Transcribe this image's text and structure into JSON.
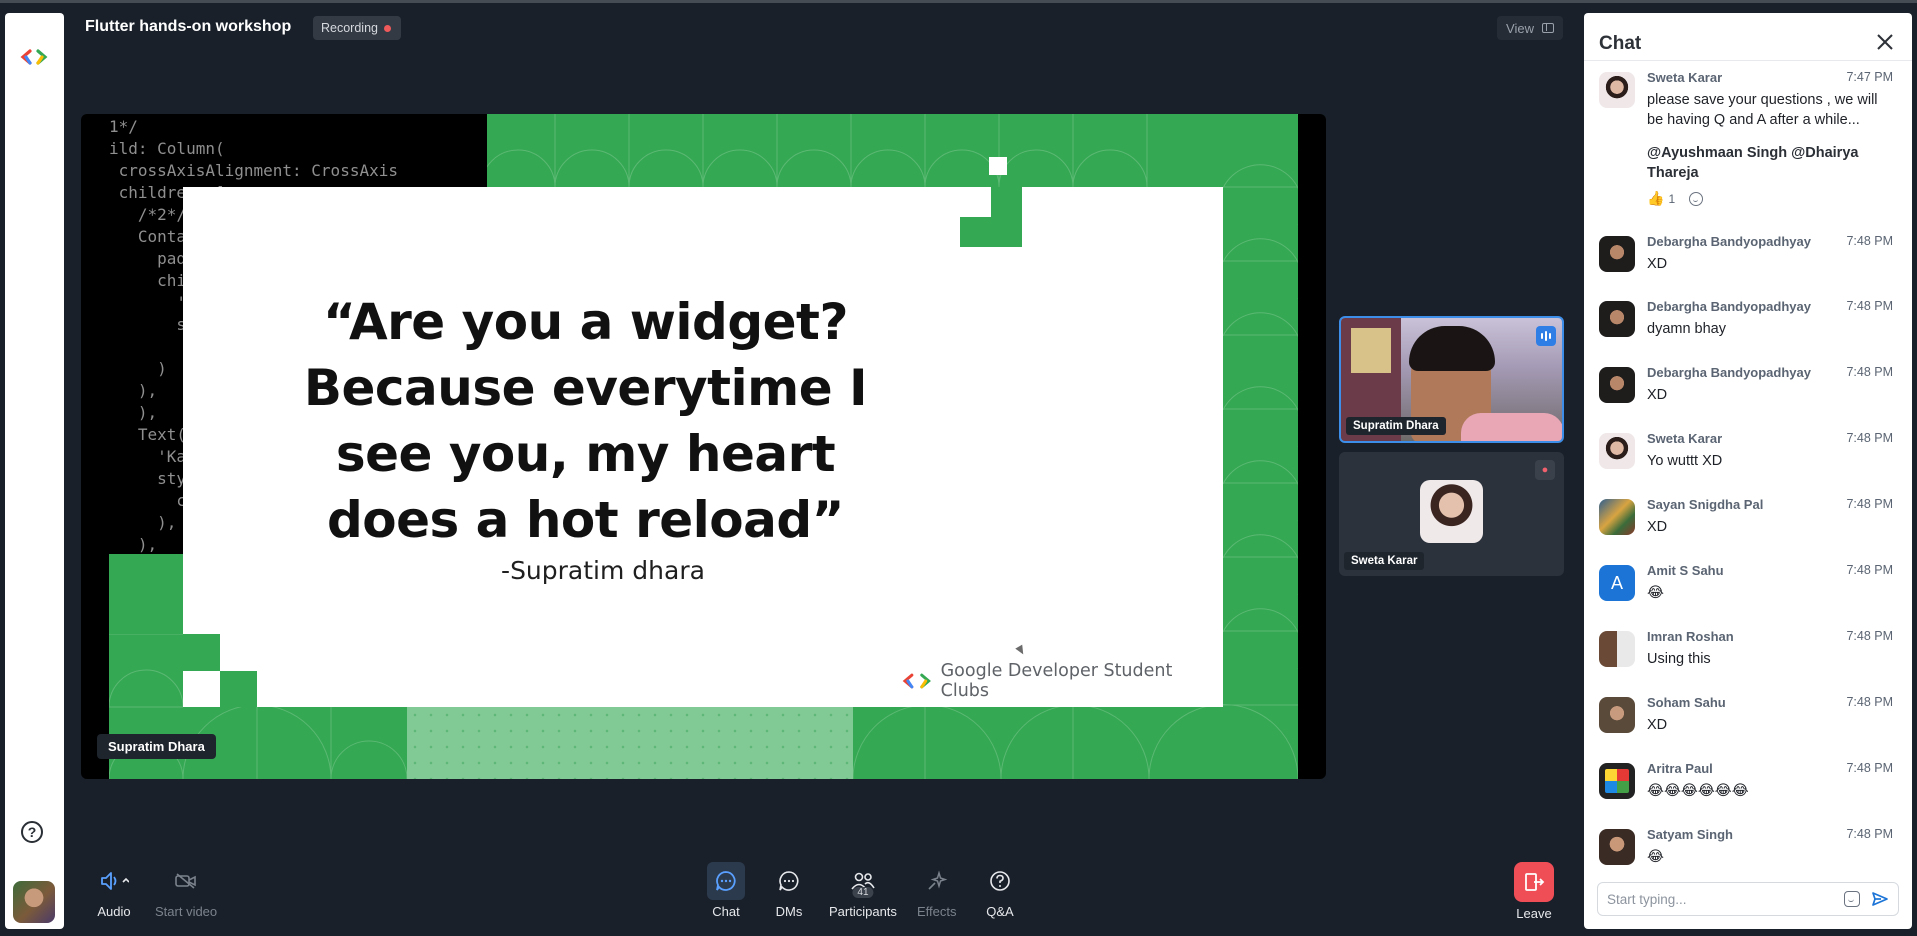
{
  "meeting": {
    "title": "Flutter hands-on workshop",
    "recording_label": "Recording",
    "view_label": "View"
  },
  "stage": {
    "speaker_label": "Supratim Dhara",
    "code_lines": [
      "1*/",
      "ild: Column(",
      " crossAxisAlignment: CrossAxis",
      " children: [",
      "   /*2*/",
      "   Conta",
      "     pad",
      "     chi",
      "       '",
      "       s",
      "       ",
      "     )",
      "   ),",
      "   ),",
      "   Text(",
      "     'Ka",
      "     sty",
      "       c",
      "     ),",
      "   ),",
      " ],"
    ],
    "slide": {
      "quote": "“Are you a widget?Because everytime I see you, my heart does a hot reload”",
      "author": "-Supratim dhara",
      "brand": "Google Developer Student Clubs"
    }
  },
  "tiles": [
    {
      "name": "Supratim Dhara",
      "speaking": true
    },
    {
      "name": "Sweta Karar",
      "muted": true
    }
  ],
  "toolbar": {
    "audio": "Audio",
    "video": "Start video",
    "chat": "Chat",
    "dms": "DMs",
    "participants": "Participants",
    "participants_count": "41",
    "effects": "Effects",
    "qa": "Q&A",
    "leave": "Leave"
  },
  "chat": {
    "title": "Chat",
    "input_placeholder": "Start typing...",
    "messages": [
      {
        "name": "Sweta Karar",
        "time": "7:47 PM",
        "text": "please save your questions , we will be having Q and A after a while...",
        "mention": "@Ayushmaan Singh @Dhairya Thareja",
        "reaction_emoji": "👍",
        "reaction_count": "1"
      },
      {
        "name": "Debargha Bandyopadhyay",
        "time": "7:48 PM",
        "text": "XD"
      },
      {
        "name": "Debargha Bandyopadhyay",
        "time": "7:48 PM",
        "text": "dyamn bhay"
      },
      {
        "name": "Debargha Bandyopadhyay",
        "time": "7:48 PM",
        "text": "XD"
      },
      {
        "name": "Sweta Karar",
        "time": "7:48 PM",
        "text": "Yo wuttt XD"
      },
      {
        "name": "Sayan Snigdha Pal",
        "time": "7:48 PM",
        "text": "XD"
      },
      {
        "name": "Amit S Sahu",
        "time": "7:48 PM",
        "text": "😂",
        "avatar_letter": "A"
      },
      {
        "name": "Imran Roshan",
        "time": "7:48 PM",
        "text": "Using this"
      },
      {
        "name": "Soham Sahu",
        "time": "7:48 PM",
        "text": "XD"
      },
      {
        "name": "Aritra Paul",
        "time": "7:48 PM",
        "text": "😂😂😂😂😂😂"
      },
      {
        "name": "Satyam Singh",
        "time": "7:48 PM",
        "text": "😂"
      }
    ]
  },
  "colors": {
    "background": "#19202a",
    "slide_green": "#34a853",
    "slide_light_green": "#81c995",
    "accent_blue": "#3c8ee8",
    "leave_red": "#f04e57",
    "recording_dot": "#f05a5a"
  }
}
